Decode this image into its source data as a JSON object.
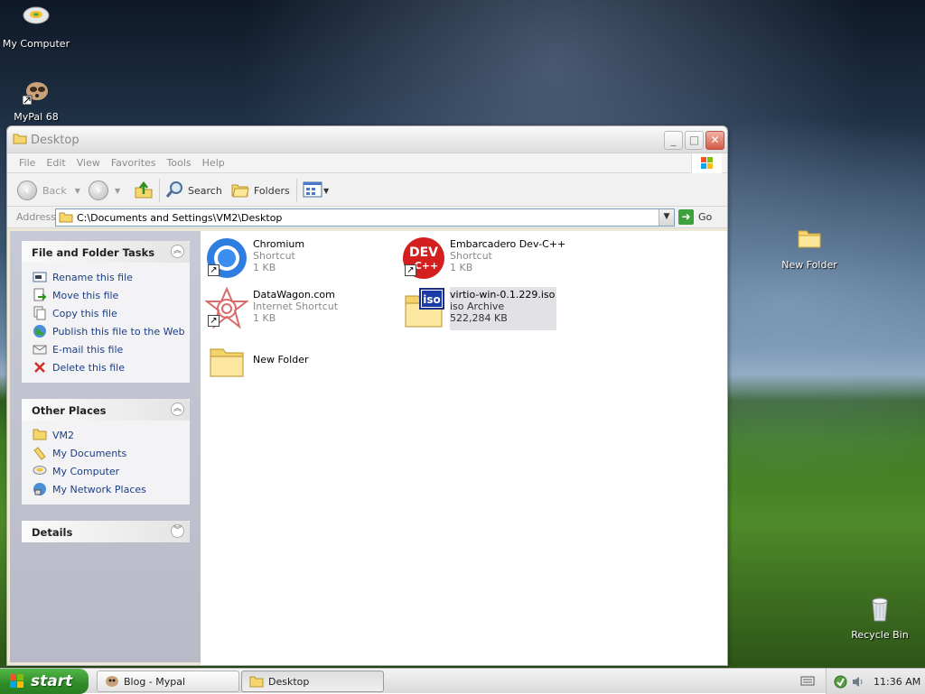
{
  "desktop": {
    "icons": [
      {
        "label": "My Computer",
        "icon": "my-computer-icon"
      },
      {
        "label": "MyPal 68",
        "icon": "mypal-icon"
      },
      {
        "label": "New Folder",
        "icon": "folder-icon"
      },
      {
        "label": "Recycle Bin",
        "icon": "recycle-bin-icon"
      }
    ]
  },
  "window": {
    "title": "Desktop",
    "menu": [
      "File",
      "Edit",
      "View",
      "Favorites",
      "Tools",
      "Help"
    ],
    "toolbar": {
      "back_label": "Back",
      "search_label": "Search",
      "folders_label": "Folders"
    },
    "address": {
      "label": "Address",
      "value": "C:\\Documents and Settings\\VM2\\Desktop",
      "go_label": "Go"
    }
  },
  "taskpane": {
    "file_tasks": {
      "title": "File and Folder Tasks",
      "items": [
        {
          "label": "Rename this file",
          "icon": "rename-icon"
        },
        {
          "label": "Move this file",
          "icon": "move-icon"
        },
        {
          "label": "Copy this file",
          "icon": "copy-icon"
        },
        {
          "label": "Publish this file to the Web",
          "icon": "globe-icon"
        },
        {
          "label": "E-mail this file",
          "icon": "email-icon"
        },
        {
          "label": "Delete this file",
          "icon": "delete-icon"
        }
      ]
    },
    "other_places": {
      "title": "Other Places",
      "items": [
        {
          "label": "VM2",
          "icon": "folder-icon"
        },
        {
          "label": "My Documents",
          "icon": "my-documents-icon"
        },
        {
          "label": "My Computer",
          "icon": "my-computer-icon"
        },
        {
          "label": "My Network Places",
          "icon": "network-icon"
        }
      ]
    },
    "details": {
      "title": "Details"
    }
  },
  "files": [
    {
      "name": "Chromium",
      "type": "Shortcut",
      "size": "1 KB",
      "icon": "chromium-icon",
      "shortcut": true
    },
    {
      "name": "Embarcadero Dev-C++",
      "type": "Shortcut",
      "size": "1 KB",
      "icon": "devcpp-icon",
      "shortcut": true,
      "icon_text_top": "DEV",
      "icon_text_bottom": "C++"
    },
    {
      "name": "DataWagon.com",
      "type": "Internet Shortcut",
      "size": "1 KB",
      "icon": "datawagon-icon",
      "shortcut": true
    },
    {
      "name": "virtio-win-0.1.229.iso",
      "type": "iso Archive",
      "size": "522,284 KB",
      "icon": "iso-icon",
      "selected": true,
      "icon_text": "iso"
    },
    {
      "name": "New Folder",
      "icon": "folder-icon"
    }
  ],
  "taskbar": {
    "start_label": "start",
    "tasks": [
      {
        "label": "Blog - Mypal",
        "icon": "mypal-icon"
      },
      {
        "label": "Desktop",
        "icon": "folder-icon",
        "active": true
      }
    ],
    "clock": "11:36 AM"
  },
  "colors": {
    "link": "#1b3e86",
    "selection": "#e1e1e6",
    "start_green": "#2e8b27"
  }
}
